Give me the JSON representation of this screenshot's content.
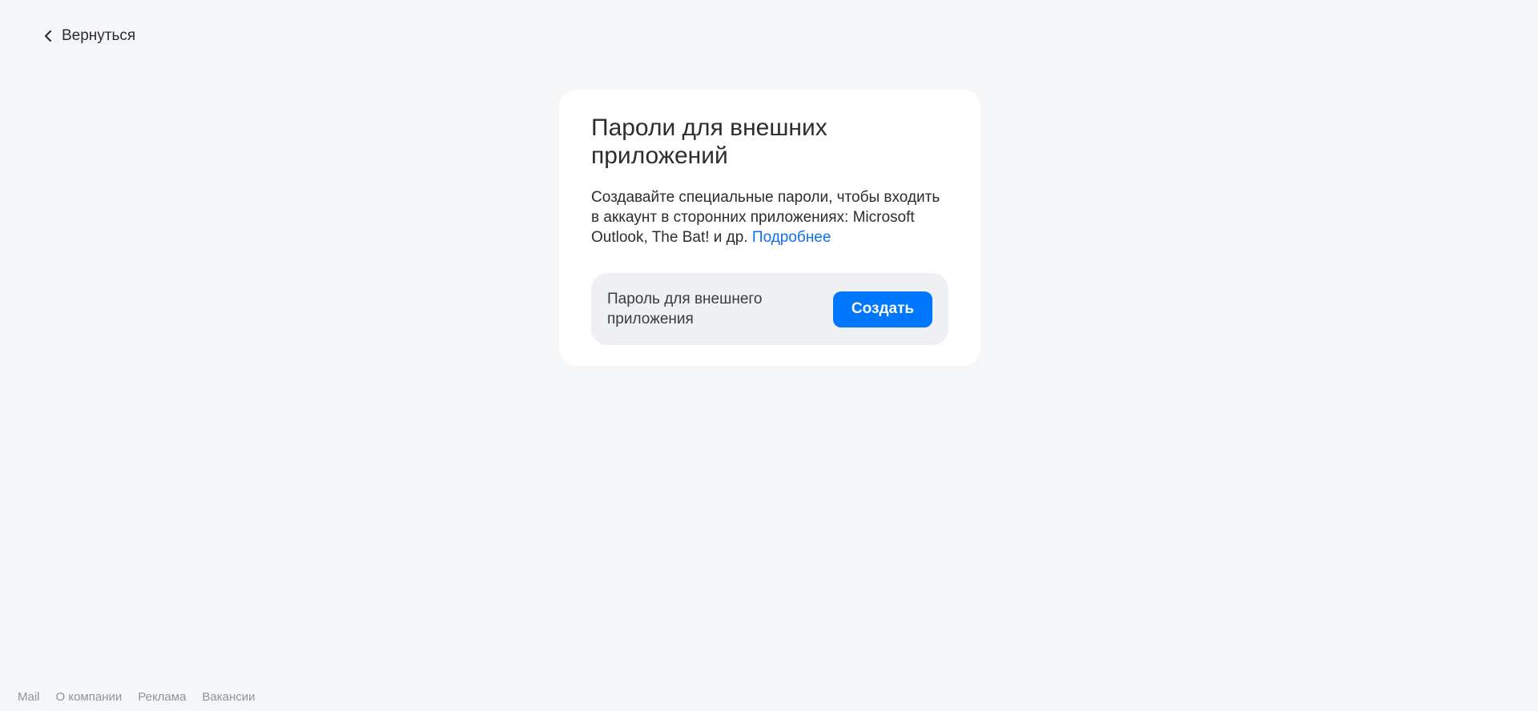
{
  "header": {
    "back_label": "Вернуться",
    "back_icon": "chevron-left-icon"
  },
  "card": {
    "title": "Пароли для внешних приложений",
    "description": "Создавайте специальные пароли, чтобы входить в аккаунт в сторонних приложениях: Microsoft Outlook, The Bat! и др.",
    "more_link": "Подробнее",
    "row_label": "Пароль для внешнего приложения",
    "create_button": "Создать"
  },
  "footer": {
    "links": [
      "Mail",
      "О компании",
      "Реклама",
      "Вакансии"
    ]
  },
  "colors": {
    "background": "#f5f6f8",
    "accent": "#0077ff",
    "link": "#0d6ef2"
  }
}
